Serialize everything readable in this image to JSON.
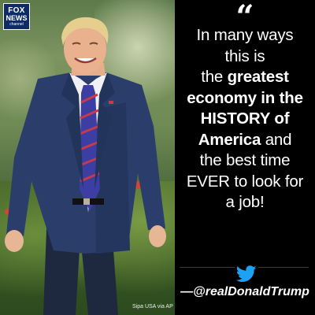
{
  "logo": {
    "line1": "FOX",
    "line2": "NEWS",
    "line3": "channel",
    "colors": {
      "background": "#0d2c66",
      "text": "#ffffff"
    }
  },
  "photo": {
    "credit": "Sipa USA via AP"
  },
  "quote": {
    "mark": "“",
    "lines": [
      [
        {
          "t": "In many ways",
          "b": false
        }
      ],
      [
        {
          "t": "this is",
          "b": false
        }
      ],
      [
        {
          "t": "the ",
          "b": false
        },
        {
          "t": "greatest",
          "b": true
        }
      ],
      [
        {
          "t": "economy in the",
          "b": true
        }
      ],
      [
        {
          "t": "HISTORY of",
          "b": true
        }
      ],
      [
        {
          "t": "America",
          "b": true
        },
        {
          "t": " and",
          "b": false
        }
      ],
      [
        {
          "t": "the best time",
          "b": false
        }
      ],
      [
        {
          "t": "EVER to look for",
          "b": false
        }
      ],
      [
        {
          "t": "a job!",
          "b": false
        }
      ]
    ]
  },
  "attribution": {
    "icon": "twitter-bird-icon",
    "handle": "—@realDonaldTrump",
    "colors": {
      "twitter": "#1da1f2"
    }
  }
}
